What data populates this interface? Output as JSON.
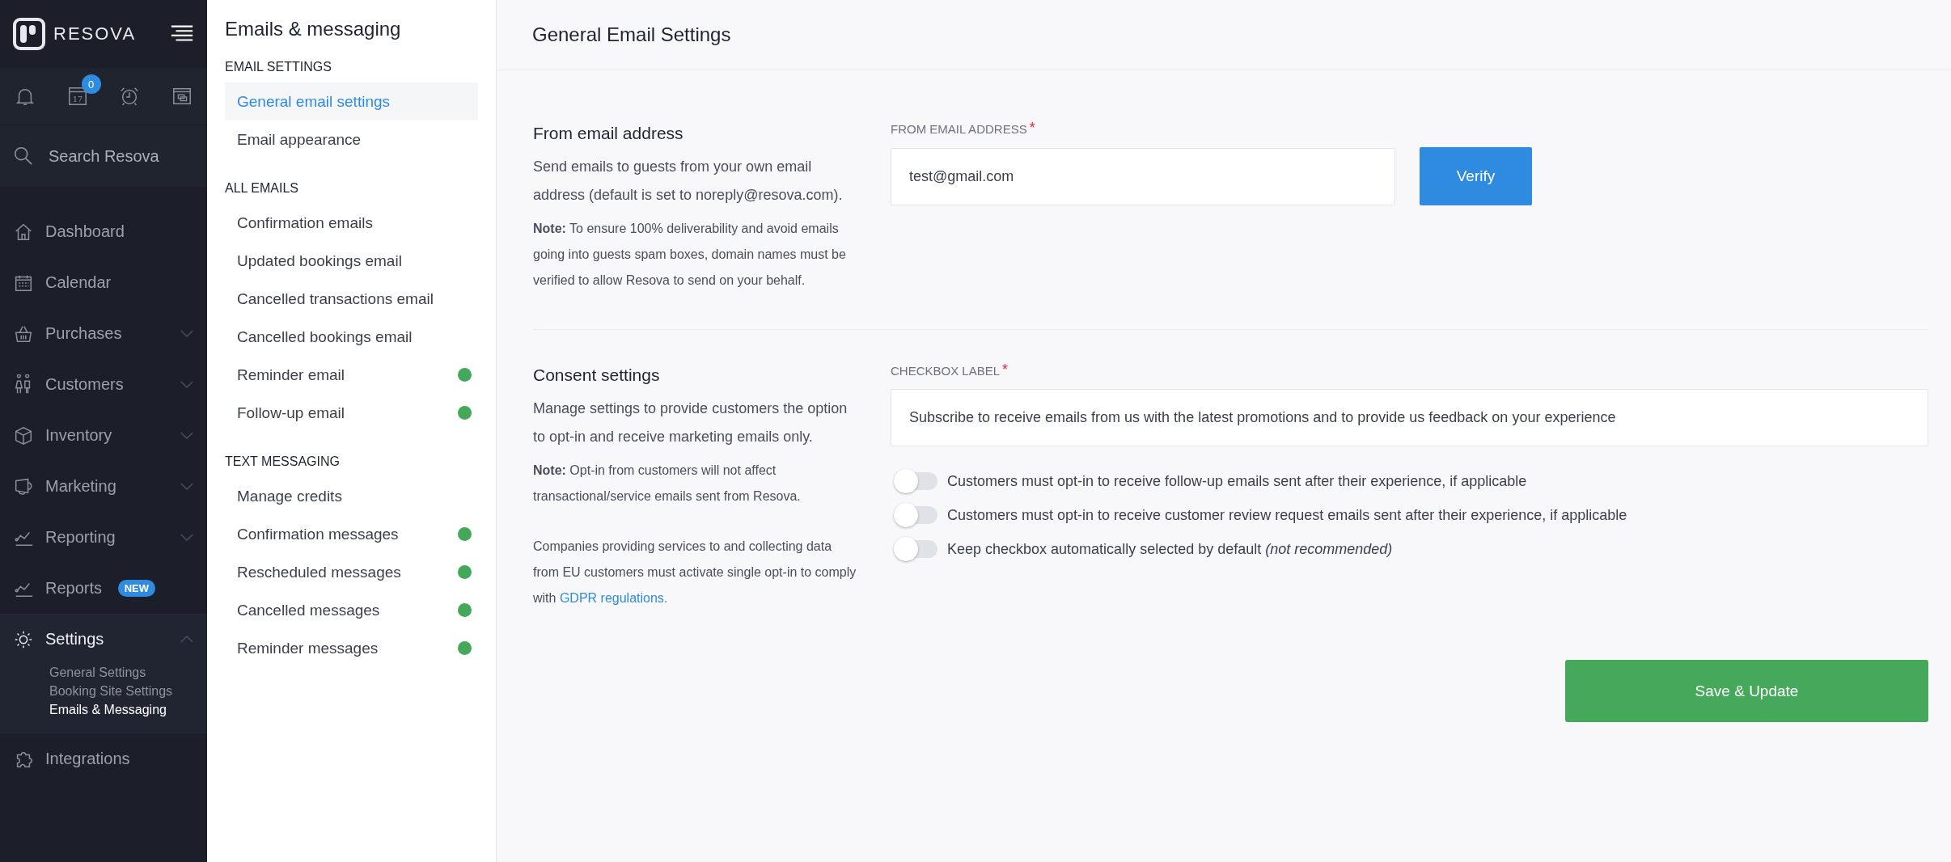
{
  "sidebar": {
    "brand": "RESOVA",
    "toolbar": {
      "calendar_day": "17",
      "calendar_badge": "0"
    },
    "search": {
      "placeholder": "Search Resova"
    },
    "nav": [
      {
        "label": "Dashboard"
      },
      {
        "label": "Calendar"
      },
      {
        "label": "Purchases",
        "expanded": false
      },
      {
        "label": "Customers",
        "expanded": false
      },
      {
        "label": "Inventory",
        "expanded": false
      },
      {
        "label": "Marketing",
        "expanded": false
      },
      {
        "label": "Reporting",
        "expanded": false
      },
      {
        "label": "Reports",
        "badge": "NEW"
      },
      {
        "label": "Settings",
        "expanded": true,
        "children": [
          {
            "label": "General Settings",
            "selected": false
          },
          {
            "label": "Booking Site Settings",
            "selected": false
          },
          {
            "label": "Emails & Messaging",
            "selected": true
          }
        ]
      },
      {
        "label": "Integrations"
      }
    ]
  },
  "subnav": {
    "title": "Emails & messaging",
    "sections": [
      {
        "heading": "EMAIL SETTINGS",
        "items": [
          {
            "label": "General email settings",
            "selected": true,
            "enabled": false
          },
          {
            "label": "Email appearance",
            "selected": false,
            "enabled": false
          }
        ]
      },
      {
        "heading": "ALL EMAILS",
        "items": [
          {
            "label": "Confirmation emails",
            "selected": false,
            "enabled": false
          },
          {
            "label": "Updated bookings email",
            "selected": false,
            "enabled": false
          },
          {
            "label": "Cancelled transactions email",
            "selected": false,
            "enabled": false
          },
          {
            "label": "Cancelled bookings email",
            "selected": false,
            "enabled": false
          },
          {
            "label": "Reminder email",
            "selected": false,
            "enabled": true
          },
          {
            "label": "Follow-up email",
            "selected": false,
            "enabled": true
          }
        ]
      },
      {
        "heading": "TEXT MESSAGING",
        "items": [
          {
            "label": "Manage credits",
            "selected": false,
            "enabled": false
          },
          {
            "label": "Confirmation messages",
            "selected": false,
            "enabled": true
          },
          {
            "label": "Rescheduled messages",
            "selected": false,
            "enabled": true
          },
          {
            "label": "Cancelled messages",
            "selected": false,
            "enabled": true
          },
          {
            "label": "Reminder messages",
            "selected": false,
            "enabled": true
          }
        ]
      }
    ]
  },
  "page": {
    "title": "General Email Settings",
    "from_email": {
      "title": "From email address",
      "description": "Send emails to guests from your own email address (default is set to noreply@resova.com).",
      "note": "**Note:** To ensure 100% deliverability and avoid emails going into guests spam boxes, domain names must be verified to allow Resova to send on your behalf.",
      "field_label": "FROM EMAIL ADDRESS",
      "required_mark": "*",
      "value": "test@gmail.com",
      "button": "Verify"
    },
    "consent": {
      "title": "Consent settings",
      "description": "Manage settings to provide customers the option to opt-in and receive marketing emails only.",
      "note": "**Note:** Opt-in from customers will not affect transactional/service emails sent from Resova.",
      "gdpr_text": "Companies providing services to and collecting data from EU customers must activate single opt-in to comply with",
      "gdpr_link": "GDPR regulations.",
      "field_label": "CHECKBOX LABEL",
      "required_mark": "*",
      "value": "Subscribe to receive emails from us with the latest promotions and to provide us feedback on your experience",
      "toggles": [
        {
          "label": "Customers must opt-in to receive follow-up emails sent after their experience, if applicable",
          "on": false
        },
        {
          "label": "Customers must opt-in to receive customer review request emails sent after their experience, if applicable",
          "on": false
        },
        {
          "label": "Keep checkbox automatically selected by default *(not recommended)*",
          "on": false
        }
      ]
    },
    "save_button": "Save & Update"
  }
}
